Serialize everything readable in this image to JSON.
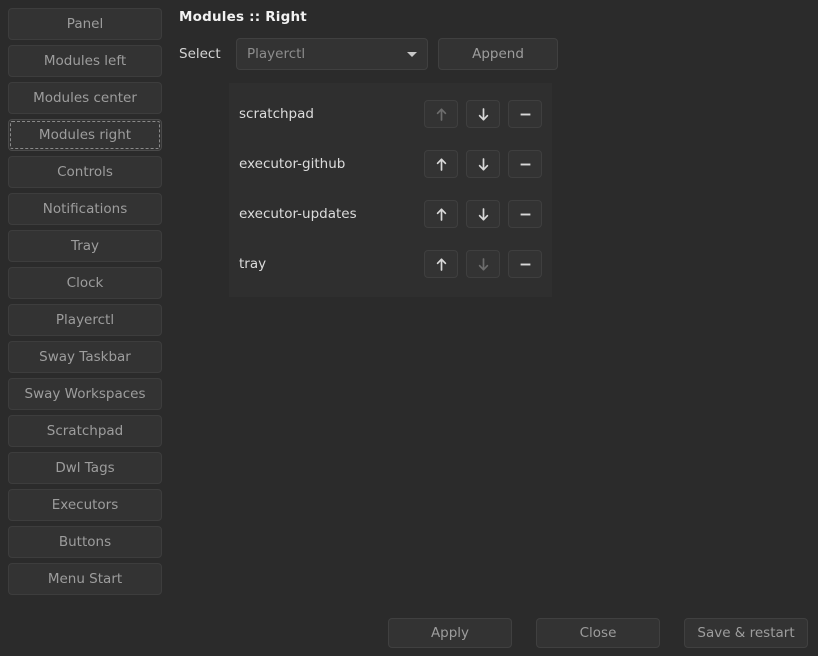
{
  "sidebar": {
    "items": [
      {
        "label": "Panel",
        "name": "sidebar-item-panel",
        "focused": false
      },
      {
        "label": "Modules left",
        "name": "sidebar-item-modules-left",
        "focused": false
      },
      {
        "label": "Modules center",
        "name": "sidebar-item-modules-center",
        "focused": false
      },
      {
        "label": "Modules right",
        "name": "sidebar-item-modules-right",
        "focused": true
      },
      {
        "label": "Controls",
        "name": "sidebar-item-controls",
        "focused": false
      },
      {
        "label": "Notifications",
        "name": "sidebar-item-notifications",
        "focused": false
      },
      {
        "label": "Tray",
        "name": "sidebar-item-tray",
        "focused": false
      },
      {
        "label": "Clock",
        "name": "sidebar-item-clock",
        "focused": false
      },
      {
        "label": "Playerctl",
        "name": "sidebar-item-playerctl",
        "focused": false
      },
      {
        "label": "Sway Taskbar",
        "name": "sidebar-item-sway-taskbar",
        "focused": false
      },
      {
        "label": "Sway Workspaces",
        "name": "sidebar-item-sway-workspaces",
        "focused": false
      },
      {
        "label": "Scratchpad",
        "name": "sidebar-item-scratchpad",
        "focused": false
      },
      {
        "label": "Dwl Tags",
        "name": "sidebar-item-dwl-tags",
        "focused": false
      },
      {
        "label": "Executors",
        "name": "sidebar-item-executors",
        "focused": false
      },
      {
        "label": "Buttons",
        "name": "sidebar-item-buttons",
        "focused": false
      },
      {
        "label": "Menu Start",
        "name": "sidebar-item-menu-start",
        "focused": false
      }
    ]
  },
  "main": {
    "title": "Modules ::  Right",
    "select_label": "Select",
    "combo": {
      "value": "Playerctl",
      "caret_icon": "chevron-down-icon"
    },
    "append_label": "Append",
    "row_actions": {
      "move_up_icon": "arrow-up-icon",
      "move_down_icon": "arrow-down-icon",
      "remove_icon": "minus-icon"
    },
    "modules": [
      {
        "name": "scratchpad",
        "move_up_enabled": false,
        "move_down_enabled": true,
        "remove_enabled": true
      },
      {
        "name": "executor-github",
        "move_up_enabled": true,
        "move_down_enabled": true,
        "remove_enabled": true
      },
      {
        "name": "executor-updates",
        "move_up_enabled": true,
        "move_down_enabled": true,
        "remove_enabled": true
      },
      {
        "name": "tray",
        "move_up_enabled": true,
        "move_down_enabled": false,
        "remove_enabled": true
      }
    ]
  },
  "bottom_bar": {
    "apply_label": "Apply",
    "close_label": "Close",
    "save_restart_label": "Save & restart"
  },
  "colors": {
    "window_background": "#2b2b2b",
    "list_background": "#2f2f2f",
    "button_background": "#333333",
    "button_border": "#404040",
    "text_primary": "#dcdcdc",
    "text_muted": "#9d9d9d",
    "text_title": "#f2f2f2",
    "glyph_enabled": "#d8d8d8",
    "glyph_disabled": "#6d6d6d"
  }
}
